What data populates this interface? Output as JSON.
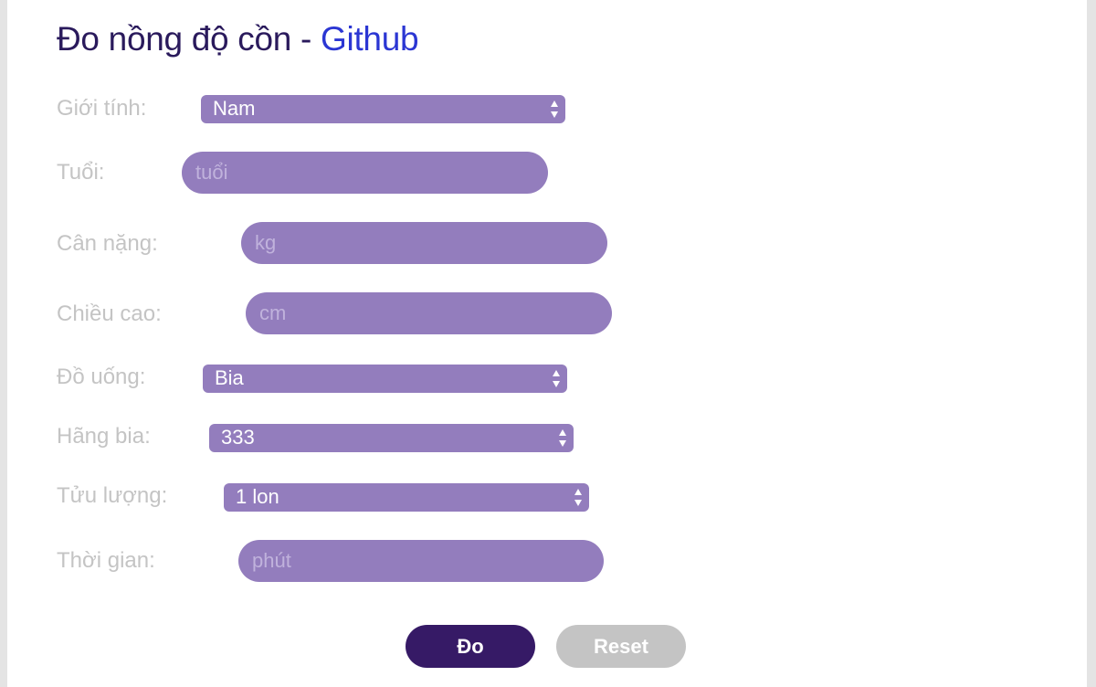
{
  "title": {
    "text": "Đo nồng độ cồn - ",
    "link": "Github"
  },
  "colors": {
    "field": "#937dbd",
    "primary_button": "#361a66",
    "reset_button": "#c4c4c4",
    "title": "#2a1a5c",
    "link": "#2b36d3"
  },
  "form": {
    "gender": {
      "label": "Giới tính:",
      "value": "Nam"
    },
    "age": {
      "label": "Tuổi:",
      "placeholder": "tuổi",
      "value": ""
    },
    "weight": {
      "label": "Cân nặng:",
      "placeholder": "kg",
      "value": ""
    },
    "height": {
      "label": "Chiều cao:",
      "placeholder": "cm",
      "value": ""
    },
    "drink": {
      "label": "Đồ uống:",
      "value": "Bia"
    },
    "brand": {
      "label": "Hãng bia:",
      "value": "333"
    },
    "amount": {
      "label": "Tửu lượng:",
      "value": "1 lon"
    },
    "time": {
      "label": "Thời gian:",
      "placeholder": "phút",
      "value": ""
    }
  },
  "buttons": {
    "measure": "Đo",
    "reset": "Reset"
  }
}
